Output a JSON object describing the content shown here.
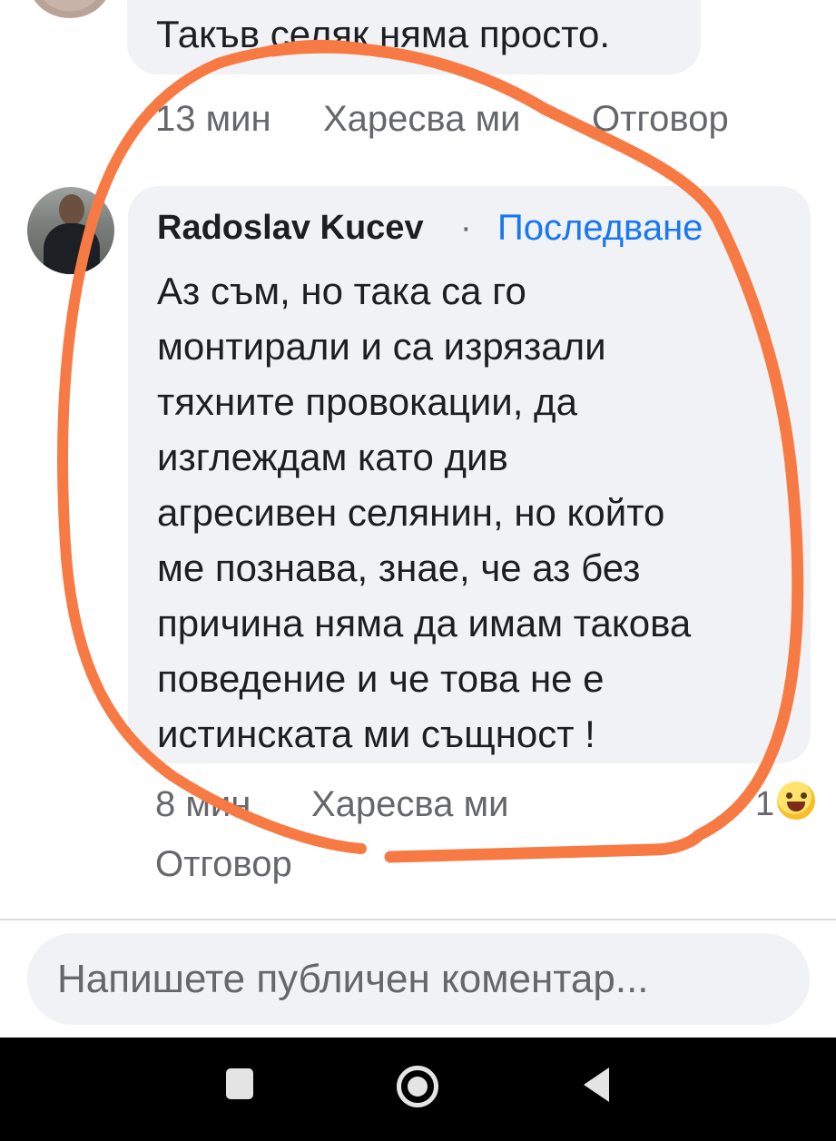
{
  "previous_comment": {
    "text": "Такъв селяк няма просто.",
    "time": "13 мин",
    "like_label": "Харесва ми",
    "reply_label": "Отговор"
  },
  "comment": {
    "author": "Radoslav Kucev",
    "separator": "·",
    "follow_label": "Последване",
    "body": "Аз съм, но така са го\nмонтирали и са изрязали\nтяхните провокации, да\nизглеждам като див\nагресивен селянин, но който\nме познава, знае, че аз без\nпричина няма да имам такова\nповедение и че това не е\nистинската ми същност !",
    "time": "8 мин",
    "like_label": "Харесва ми",
    "reply_label": "Отговор",
    "reaction_count": "1",
    "reaction_icon": "laughing-emoji-icon"
  },
  "composer": {
    "placeholder": "Напишете публичен коментар..."
  },
  "navigation_bar": {
    "icons": [
      "recent-apps-icon",
      "home-icon",
      "back-icon"
    ]
  },
  "colors": {
    "annotation": "#f77a45",
    "bubble": "#f0f2f5",
    "link": "#1877f2",
    "secondary_text": "#65676b"
  }
}
